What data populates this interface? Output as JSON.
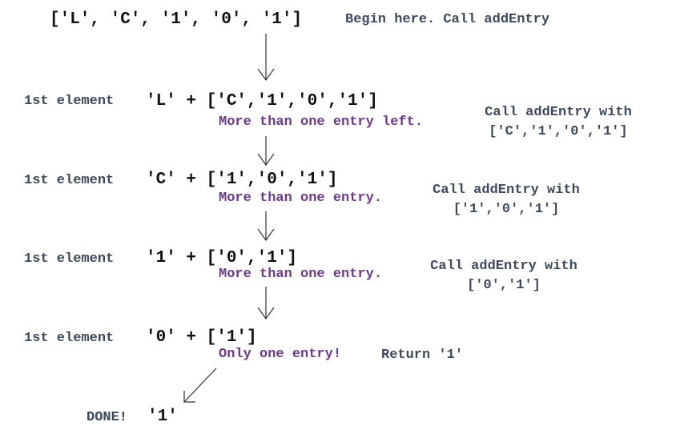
{
  "top": {
    "list": "['L', 'C', '1', '0', '1']",
    "note": "Begin here. Call addEntry"
  },
  "steps": [
    {
      "label": "1st element",
      "expr": "'L' + ['C','1','0','1']",
      "status": "More than one entry left.",
      "call": "Call addEntry with",
      "args": "['C','1','0','1']"
    },
    {
      "label": "1st element",
      "expr": "'C' + ['1','0','1']",
      "status": "More than one entry.",
      "call": "Call addEntry with",
      "args": "['1','0','1']"
    },
    {
      "label": "1st element",
      "expr": "'1' + ['0','1']",
      "status": "More than one entry.",
      "call": "Call addEntry with",
      "args": "['0','1']"
    },
    {
      "label": "1st element",
      "expr": "'0' + ['1']",
      "status": "Only one entry!",
      "ret": "Return '1'"
    }
  ],
  "done": {
    "label": "DONE!",
    "value": "'1'"
  },
  "colors": {
    "code": "#111111",
    "note": "#3c4a5c",
    "status": "#6b3a8c",
    "arrow": "#333333"
  }
}
